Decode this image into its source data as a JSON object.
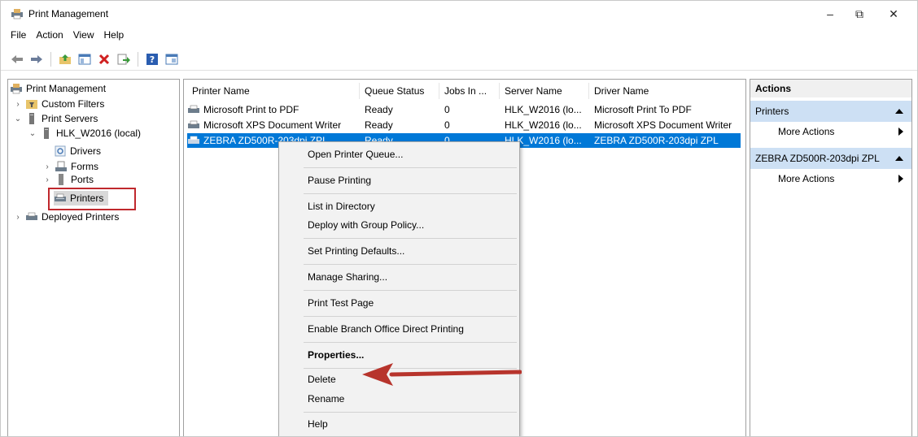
{
  "window": {
    "title": "Print Management"
  },
  "window_controls": {
    "minimize": "–",
    "maximize": "⧉",
    "close": "✕"
  },
  "menu": [
    "File",
    "Action",
    "View",
    "Help"
  ],
  "toolbar_icons": [
    "back-arrow-icon",
    "forward-arrow-icon",
    "up-folder-icon",
    "show-hide-tree-icon",
    "delete-icon",
    "export-list-icon",
    "help-icon",
    "properties-icon"
  ],
  "tree": {
    "root": "Print Management",
    "custom_filters": "Custom Filters",
    "print_servers": "Print Servers",
    "server": "HLK_W2016 (local)",
    "drivers": "Drivers",
    "forms": "Forms",
    "ports": "Ports",
    "printers": "Printers",
    "deployed_printers": "Deployed Printers"
  },
  "list": {
    "columns": [
      "Printer Name",
      "Queue Status",
      "Jobs In ...",
      "Server Name",
      "Driver Name"
    ],
    "rows": [
      {
        "name": "Microsoft Print to PDF",
        "status": "Ready",
        "jobs": "0",
        "server": "HLK_W2016 (lo...",
        "driver": "Microsoft Print To PDF"
      },
      {
        "name": "Microsoft XPS Document Writer",
        "status": "Ready",
        "jobs": "0",
        "server": "HLK_W2016 (lo...",
        "driver": "Microsoft XPS Document Writer"
      },
      {
        "name": "ZEBRA ZD500R-203dpi ZPL",
        "status": "Ready",
        "jobs": "0",
        "server": "HLK_W2016 (lo...",
        "driver": "ZEBRA ZD500R-203dpi ZPL"
      }
    ]
  },
  "actions": {
    "header": "Actions",
    "section1": "Printers",
    "more1": "More Actions",
    "section2": "ZEBRA ZD500R-203dpi ZPL",
    "more2": "More Actions"
  },
  "context_menu": {
    "open_queue": "Open Printer Queue...",
    "pause": "Pause Printing",
    "list_dir": "List in Directory",
    "deploy": "Deploy with Group Policy...",
    "set_defaults": "Set Printing Defaults...",
    "manage_sharing": "Manage Sharing...",
    "print_test": "Print Test Page",
    "branch_office": "Enable Branch Office Direct Printing",
    "properties": "Properties...",
    "delete": "Delete",
    "rename": "Rename",
    "help": "Help"
  },
  "colors": {
    "selection": "#0078d7",
    "actions_section": "#cde0f4",
    "annotation": "#c0282d"
  }
}
